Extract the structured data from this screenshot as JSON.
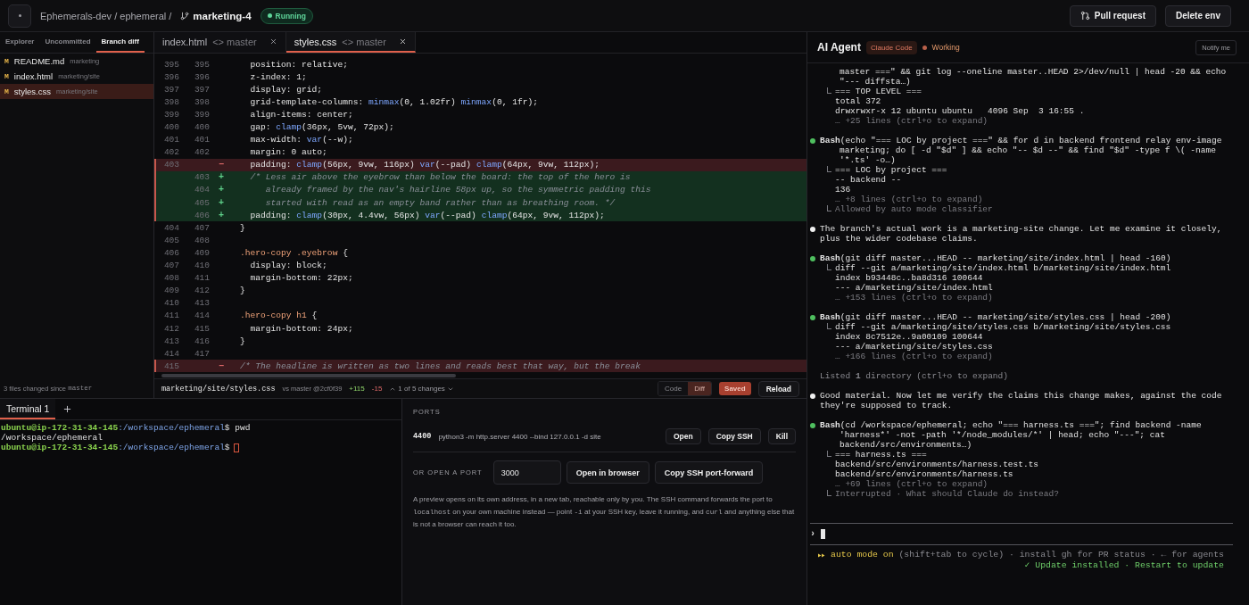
{
  "top_bar": {
    "breadcrumb": "Ephemerals-dev / ephemeral /",
    "branch": "marketing-4",
    "status": "Running",
    "actions": [
      {
        "label": "Pull request",
        "kind": "pr"
      },
      {
        "label": "Delete env",
        "kind": "plain"
      }
    ]
  },
  "explorer": {
    "tabs": [
      {
        "label": "Explorer",
        "selected": false
      },
      {
        "label": "Uncommitted",
        "selected": false
      },
      {
        "label": "Branch diff",
        "selected": true
      }
    ],
    "files": [
      {
        "status": "M",
        "name": "README.md",
        "path": "marketing",
        "selected": false
      },
      {
        "status": "M",
        "name": "index.html",
        "path": "marketing/site",
        "selected": false
      },
      {
        "status": "M",
        "name": "styles.css",
        "path": "marketing/site",
        "selected": true
      }
    ],
    "footer": {
      "text": "3 files changed since",
      "ref": "master"
    }
  },
  "editor": {
    "tabs": [
      {
        "name": "index.html",
        "compare": "<> master",
        "selected": false
      },
      {
        "name": "styles.css",
        "compare": "<> master",
        "selected": true
      }
    ],
    "lines": [
      {
        "old": "395",
        "new": "395",
        "kind": "context",
        "comment": false,
        "text": "  position: relative;"
      },
      {
        "old": "396",
        "new": "396",
        "kind": "context",
        "comment": false,
        "text": "  z-index: 1;"
      },
      {
        "old": "397",
        "new": "397",
        "kind": "context",
        "comment": false,
        "text": "  display: grid;"
      },
      {
        "old": "398",
        "new": "398",
        "kind": "context",
        "comment": false,
        "text": "  grid-template-columns: minmax(0, 1.02fr) minmax(0, 1fr);"
      },
      {
        "old": "399",
        "new": "399",
        "kind": "context",
        "comment": false,
        "text": "  align-items: center;"
      },
      {
        "old": "400",
        "new": "400",
        "kind": "context",
        "comment": false,
        "text": "  gap: clamp(36px, 5vw, 72px);"
      },
      {
        "old": "401",
        "new": "401",
        "kind": "context",
        "comment": false,
        "text": "  max-width: var(--w);"
      },
      {
        "old": "402",
        "new": "402",
        "kind": "context",
        "comment": false,
        "text": "  margin: 0 auto;"
      },
      {
        "old": "403",
        "kind": "removed",
        "sign": "−",
        "comment": false,
        "text": "  padding: clamp(56px, 9vw, 116px) var(--pad) clamp(64px, 9vw, 112px);"
      },
      {
        "new": "403",
        "kind": "added",
        "sign": "+",
        "comment": true,
        "text": "  /* Less air above the eyebrow than below the board: the top of the hero is"
      },
      {
        "new": "404",
        "kind": "added",
        "sign": "+",
        "comment": true,
        "text": "     already framed by the nav's hairline 58px up, so the symmetric padding this"
      },
      {
        "new": "405",
        "kind": "added",
        "sign": "+",
        "comment": true,
        "text": "     started with read as an empty band rather than as breathing room. */"
      },
      {
        "new": "406",
        "kind": "added",
        "sign": "+",
        "comment": false,
        "text": "  padding: clamp(30px, 4.4vw, 56px) var(--pad) clamp(64px, 9vw, 112px);"
      },
      {
        "old": "404",
        "new": "407",
        "kind": "context",
        "comment": false,
        "text": "}"
      },
      {
        "old": "405",
        "new": "408",
        "kind": "context"
      },
      {
        "old": "406",
        "new": "409",
        "kind": "context",
        "comment": false,
        "text": ".hero-copy .eyebrow {"
      },
      {
        "old": "407",
        "new": "410",
        "kind": "context",
        "comment": false,
        "text": "  display: block;"
      },
      {
        "old": "408",
        "new": "411",
        "kind": "context",
        "comment": false,
        "text": "  margin-bottom: 22px;"
      },
      {
        "old": "409",
        "new": "412",
        "kind": "context",
        "comment": false,
        "text": "}"
      },
      {
        "old": "410",
        "new": "413",
        "kind": "context"
      },
      {
        "old": "411",
        "new": "414",
        "kind": "context",
        "comment": false,
        "text": ".hero-copy h1 {"
      },
      {
        "old": "412",
        "new": "415",
        "kind": "context",
        "comment": false,
        "text": "  margin-bottom: 24px;"
      },
      {
        "old": "413",
        "new": "416",
        "kind": "context",
        "comment": false,
        "text": "}"
      },
      {
        "old": "414",
        "new": "417",
        "kind": "context"
      },
      {
        "old": "415",
        "kind": "removed",
        "sign": "−",
        "comment": true,
        "text": "/* The headline is written as two lines and reads best that way, but the break"
      }
    ],
    "status_bar": {
      "path": "marketing/site/styles.css",
      "base": "vs master @2cf0f39",
      "added": "+115",
      "removed": "-15",
      "changes": "1 of 5 changes",
      "view_modes": [
        {
          "label": "Code",
          "selected": false
        },
        {
          "label": "Diff",
          "selected": true
        }
      ],
      "save_state": "Saved",
      "reload": "Reload"
    }
  },
  "terminal": {
    "tabs": [
      {
        "label": "Terminal 1",
        "selected": true
      }
    ],
    "lines": [
      {
        "kind": "prompt",
        "user": "ubuntu@ip-172-31-34-145",
        "path": ":/workspace/ephemeral",
        "command": "$ pwd",
        "cursor": false
      },
      {
        "kind": "output",
        "text": "/workspace/ephemeral"
      },
      {
        "kind": "prompt",
        "user": "ubuntu@ip-172-31-34-145",
        "path": ":/workspace/ephemeral",
        "command": "$",
        "cursor": true
      }
    ]
  },
  "ports": {
    "title": "PORTS",
    "items": [
      {
        "port": "4400",
        "command": "python3 -m http.server 4400 --bind 127.0.0.1 -d site",
        "actions": [
          "Open",
          "Copy SSH",
          "Kill"
        ]
      }
    ],
    "open_port": {
      "label": "OR OPEN A PORT",
      "value": "3000",
      "actions": [
        "Open in browser",
        "Copy SSH port-forward"
      ]
    },
    "help": [
      {
        "text": "A preview opens on its own address, in a new tab, reachable only by you. The SSH command forwards the port to ",
        "code": false
      },
      {
        "text": "localhost",
        "code": true
      },
      {
        "text": " on your own machine instead — point ",
        "code": false
      },
      {
        "text": "-i",
        "code": true
      },
      {
        "text": " at your SSH key, leave it running, and ",
        "code": false
      },
      {
        "text": "curl",
        "code": true
      },
      {
        "text": " and anything else that is not a browser can reach it too.",
        "code": false
      }
    ]
  },
  "agent": {
    "title": "AI Agent",
    "engine": "Claude Code",
    "status": "Working",
    "notify": "Notify me",
    "log": [
      {
        "kind": "continuation",
        "command": "master ===\" && git log --oneline master..HEAD 2>/dev/null | head -20 && echo \"--- diffsta…)",
        "output": [
          {
            "text": "=== TOP LEVEL ===",
            "dim": false,
            "elbow": true
          },
          {
            "text": "total 372",
            "dim": false,
            "elbow": false
          },
          {
            "text": "drwxrwxr-x 12 ubuntu ubuntu   4096 Sep  3 16:55 .",
            "dim": false,
            "elbow": false
          },
          {
            "text": "… +25 lines (ctrl+o to expand)",
            "dim": true,
            "elbow": false
          }
        ]
      },
      {
        "kind": "tool",
        "tool": "Bash",
        "command": "(echo \"=== LOC by project ===\" && for d in backend frontend relay env-image marketing; do [ -d \"$d\" ] && echo \"-- $d --\" && find \"$d\" -type f \\( -name '*.ts' -o…)",
        "output": [
          {
            "text": "=== LOC by project ===",
            "dim": false,
            "elbow": true
          },
          {
            "text": "-- backend --",
            "dim": false,
            "elbow": false
          },
          {
            "text": "136",
            "dim": false,
            "elbow": false
          },
          {
            "text": "… +8 lines (ctrl+o to expand)",
            "dim": true,
            "elbow": false
          },
          {
            "text": "Allowed by auto mode classifier",
            "dim": true,
            "elbow": true
          }
        ]
      },
      {
        "kind": "message",
        "text": "The branch's actual work is a marketing-site change. Let me examine it closely, plus the wider codebase claims."
      },
      {
        "kind": "tool",
        "tool": "Bash",
        "command": "(git diff master...HEAD -- marketing/site/index.html | head -160)",
        "output": [
          {
            "text": "diff --git a/marketing/site/index.html b/marketing/site/index.html",
            "dim": false,
            "elbow": true
          },
          {
            "text": "index b93448c..ba8d316 100644",
            "dim": false,
            "elbow": false
          },
          {
            "text": "--- a/marketing/site/index.html",
            "dim": false,
            "elbow": false
          },
          {
            "text": "… +153 lines (ctrl+o to expand)",
            "dim": true,
            "elbow": false
          }
        ]
      },
      {
        "kind": "tool",
        "tool": "Bash",
        "command": "(git diff master...HEAD -- marketing/site/styles.css | head -200)",
        "output": [
          {
            "text": "diff --git a/marketing/site/styles.css b/marketing/site/styles.css",
            "dim": false,
            "elbow": true
          },
          {
            "text": "index 8c7512e..9a00109 100644",
            "dim": false,
            "elbow": false
          },
          {
            "text": "--- a/marketing/site/styles.css",
            "dim": false,
            "elbow": false
          },
          {
            "text": "… +166 lines (ctrl+o to expand)",
            "dim": true,
            "elbow": false
          }
        ]
      },
      {
        "kind": "info",
        "text": "Listed **1** directory (ctrl+o to expand)"
      },
      {
        "kind": "message",
        "text": "Good material. Now let me verify the claims this change makes, against the code they're supposed to track."
      },
      {
        "kind": "tool",
        "tool": "Bash",
        "command": "(cd /workspace/ephemeral; echo \"=== harness.ts ===\"; find backend -name 'harness*' -not -path '*/node_modules/*' | head; echo \"---\"; cat backend/src/environments…)",
        "output": [
          {
            "text": "=== harness.ts ===",
            "dim": false,
            "elbow": true
          },
          {
            "text": "backend/src/environments/harness.test.ts",
            "dim": false,
            "elbow": false
          },
          {
            "text": "backend/src/environments/harness.ts",
            "dim": false,
            "elbow": false
          },
          {
            "text": "… +69 lines (ctrl+o to expand)",
            "dim": true,
            "elbow": false
          },
          {
            "text": "Interrupted · What should Claude do instead?",
            "dim": true,
            "elbow": true
          }
        ]
      }
    ],
    "prompt": "›",
    "footer": [
      {
        "kind": "mode",
        "label": "auto mode on",
        "text": " (shift+tab to cycle) · install gh for PR status · ← for agents"
      },
      {
        "kind": "notice",
        "text": "✓ Update installed · Restart to update"
      }
    ]
  }
}
